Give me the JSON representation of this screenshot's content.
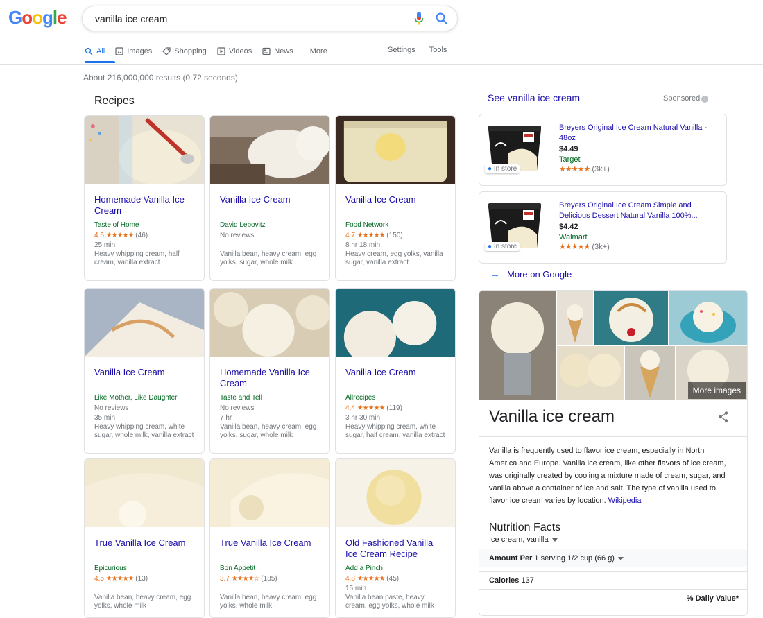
{
  "search": {
    "query": "vanilla ice cream",
    "logo_letters": [
      "G",
      "o",
      "o",
      "g",
      "l",
      "e"
    ],
    "logo_colors": [
      "#4285f4",
      "#ea4335",
      "#fbbc05",
      "#4285f4",
      "#34a853",
      "#ea4335"
    ]
  },
  "tabs": [
    {
      "label": "All",
      "icon": "search-icon"
    },
    {
      "label": "Images",
      "icon": "image-icon"
    },
    {
      "label": "Shopping",
      "icon": "tag-icon"
    },
    {
      "label": "Videos",
      "icon": "play-icon"
    },
    {
      "label": "News",
      "icon": "newspaper-icon"
    },
    {
      "label": "More",
      "icon": "more-vert-icon"
    }
  ],
  "tools": {
    "settings": "Settings",
    "tools": "Tools"
  },
  "result_stats": "About 216,000,000 results (0.72 seconds)",
  "recipes": {
    "title": "Recipes",
    "cards": [
      {
        "title": "Homemade Vanilla Ice Cream",
        "source": "Taste of Home",
        "rating": "4.6",
        "stars": "★★★★★",
        "reviews": "(46)",
        "time": "25 min",
        "ingredients": "Heavy whipping cream, half cream, vanilla extract"
      },
      {
        "title": "Vanilla Ice Cream",
        "source": "David Lebovitz",
        "rating": "",
        "stars": "",
        "reviews": "No reviews",
        "time": "",
        "ingredients": "Vanilla bean, heavy cream, egg yolks, sugar, whole milk"
      },
      {
        "title": "Vanilla Ice Cream",
        "source": "Food Network",
        "rating": "4.7",
        "stars": "★★★★★",
        "reviews": "(150)",
        "time": "8 hr 18 min",
        "ingredients": "Heavy cream, egg yolks, vanilla sugar, vanilla extract"
      },
      {
        "title": "Vanilla Ice Cream",
        "source": "Like Mother, Like Daughter",
        "rating": "",
        "stars": "",
        "reviews": "No reviews",
        "time": "35 min",
        "ingredients": "Heavy whipping cream, white sugar, whole milk, vanilla extract"
      },
      {
        "title": "Homemade Vanilla Ice Cream",
        "source": "Taste and Tell",
        "rating": "",
        "stars": "",
        "reviews": "No reviews",
        "time": "7 hr",
        "ingredients": "Vanilla bean, heavy cream, egg yolks, sugar, whole milk"
      },
      {
        "title": "Vanilla Ice Cream",
        "source": "Allrecipes",
        "rating": "4.4",
        "stars": "★★★★★",
        "reviews": "(119)",
        "time": "3 hr 30 min",
        "ingredients": "Heavy whipping cream, white sugar, half cream, vanilla extract"
      },
      {
        "title": "True Vanilla Ice Cream",
        "source": "Epicurious",
        "rating": "4.5",
        "stars": "★★★★★",
        "reviews": "(13)",
        "time": "",
        "ingredients": "Vanilla bean, heavy cream, egg yolks, whole milk"
      },
      {
        "title": "True Vanilla Ice Cream",
        "source": "Bon Appetit",
        "rating": "3.7",
        "stars": "★★★★☆",
        "reviews": "(185)",
        "time": "",
        "ingredients": "Vanilla bean, heavy cream, egg yolks, whole milk"
      },
      {
        "title": "Old Fashioned Vanilla Ice Cream Recipe",
        "source": "Add a Pinch",
        "rating": "4.8",
        "stars": "★★★★★",
        "reviews": "(45)",
        "time": "15 min",
        "ingredients": "Vanilla bean paste, heavy cream, egg yolks, whole milk"
      }
    ]
  },
  "shopping": {
    "see_link": "See vanilla ice cream",
    "sponsored": "Sponsored",
    "products": [
      {
        "name": "Breyers Original Ice Cream Natural Vanilla - 48oz",
        "price": "$4.49",
        "store": "Target",
        "stars": "★★★★★",
        "reviews": "(3k+)",
        "badge": "In store"
      },
      {
        "name": "Breyers Original Ice Cream Simple and Delicious Dessert Natural Vanilla 100%...",
        "price": "$4.42",
        "store": "Walmart",
        "stars": "★★★★★",
        "reviews": "(3k+)",
        "badge": "In store"
      }
    ],
    "more_link": "More on Google"
  },
  "knowledge_panel": {
    "more_images": "More images",
    "title": "Vanilla ice cream",
    "description": "Vanilla is frequently used to flavor ice cream, especially in North America and Europe. Vanilla ice cream, like other flavors of ice cream, was originally created by cooling a mixture made of cream, sugar, and vanilla above a container of ice and salt. The type of vanilla used to flavor ice cream varies by location.",
    "wiki_link": "Wikipedia",
    "nutrition_title": "Nutrition Facts",
    "nutrition_item": "Ice cream, vanilla",
    "amount_label": "Amount Per",
    "amount_value": "1 serving 1/2 cup (66 g)",
    "calories_label": "Calories",
    "calories_value": "137",
    "daily_value": "% Daily Value*"
  }
}
